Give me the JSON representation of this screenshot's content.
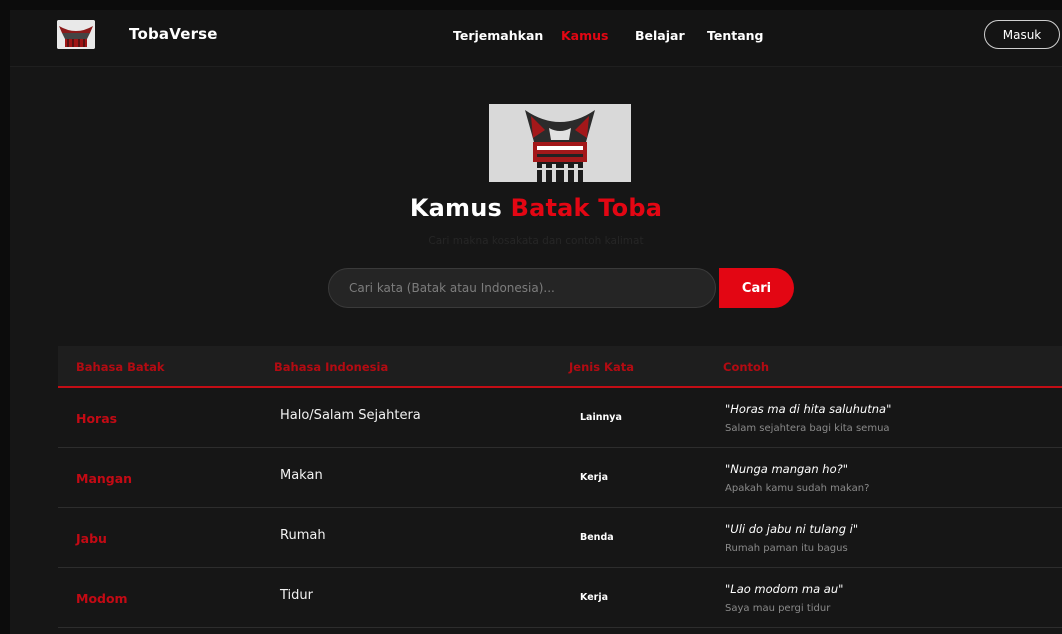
{
  "navbar": {
    "brand": "TobaVerse",
    "links": [
      {
        "label": "Terjemahkan"
      },
      {
        "label": "Kamus"
      },
      {
        "label": "Belajar"
      },
      {
        "label": "Tentang"
      }
    ],
    "login_label": "Masuk"
  },
  "hero": {
    "title_main": "Kamus ",
    "title_accent": "Batak Toba",
    "subtitle": "Cari makna kosakata dan contoh kalimat"
  },
  "search": {
    "placeholder": "Cari kata (Batak atau Indonesia)...",
    "value": "",
    "button_label": "Cari"
  },
  "table": {
    "headers": [
      "Bahasa Batak",
      "Bahasa Indonesia",
      "Jenis Kata",
      "Contoh"
    ],
    "rows": [
      {
        "batak": "Horas",
        "indonesia": "Halo/Salam Sejahtera",
        "jenis": "Lainnya",
        "contoh": "\"Horas ma di hita saluhutna\"",
        "terjemahan": "Salam sejahtera bagi kita semua"
      },
      {
        "batak": "Mangan",
        "indonesia": "Makan",
        "jenis": "Kerja",
        "contoh": "\"Nunga mangan ho?\"",
        "terjemahan": "Apakah kamu sudah makan?"
      },
      {
        "batak": "Jabu",
        "indonesia": "Rumah",
        "jenis": "Benda",
        "contoh": "\"Uli do jabu ni tulang i\"",
        "terjemahan": "Rumah paman itu bagus"
      },
      {
        "batak": "Modom",
        "indonesia": "Tidur",
        "jenis": "Kerja",
        "contoh": "\"Lao modom ma au\"",
        "terjemahan": "Saya mau pergi tidur"
      }
    ]
  },
  "colors": {
    "accent": "#e30613",
    "background": "#161616"
  },
  "icons": {
    "logo": "rumah-bolon-logo-icon",
    "hero": "rumah-bolon-illustration-icon"
  }
}
